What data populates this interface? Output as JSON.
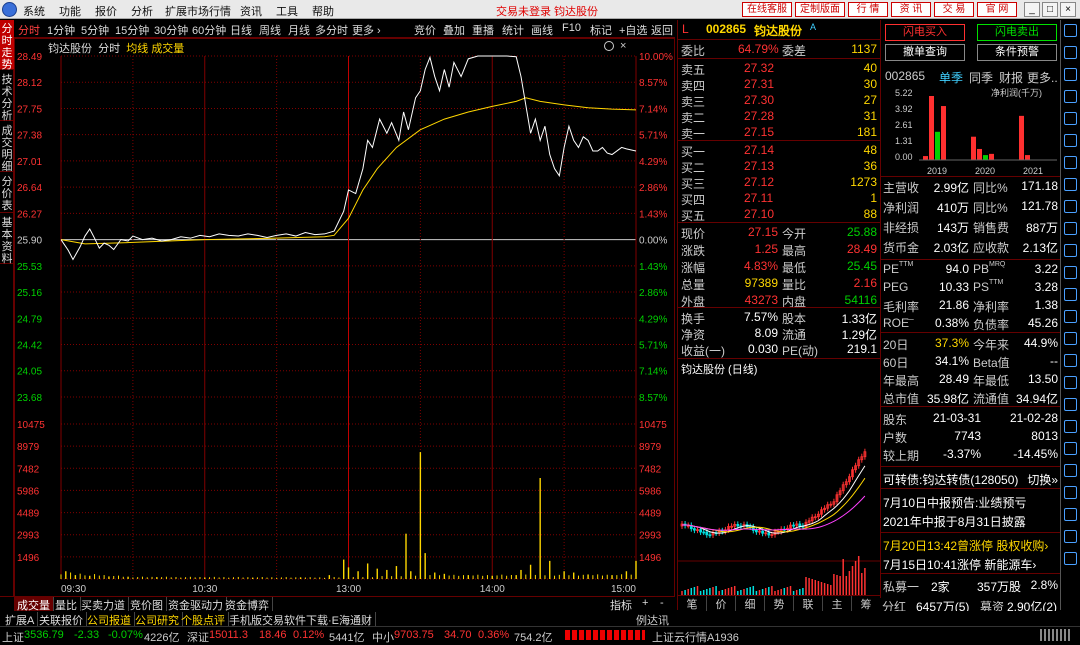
{
  "menu": {
    "items": [
      "系统",
      "功能",
      "报价",
      "分析",
      "扩展市场行情",
      "资讯",
      "工具",
      "帮助"
    ],
    "status": "交易未登录  钧达股份",
    "top_buttons": [
      "在线客服",
      "定制版面",
      "行  情",
      "资  讯",
      "交  易",
      "官  网"
    ],
    "win": [
      "_",
      "□",
      "×"
    ]
  },
  "tabs": [
    {
      "label": "分时",
      "on": true
    },
    {
      "label": "1分钟"
    },
    {
      "label": "5分钟"
    },
    {
      "label": "15分钟"
    },
    {
      "label": "30分钟"
    },
    {
      "label": "60分钟"
    },
    {
      "label": "日线"
    },
    {
      "label": "周线"
    },
    {
      "label": "月线"
    },
    {
      "label": "多分时"
    },
    {
      "label": "更多 ›"
    },
    {
      "label": "竞价"
    },
    {
      "label": "叠加"
    },
    {
      "label": "重播"
    },
    {
      "label": "统计"
    },
    {
      "label": "画线"
    },
    {
      "label": "F10"
    },
    {
      "label": "标记"
    },
    {
      "label": "+自选"
    },
    {
      "label": "返回"
    }
  ],
  "vtabs": [
    {
      "label": "分时走势",
      "on": true
    },
    {
      "label": "技术分析"
    },
    {
      "label": "成交明细"
    },
    {
      "label": "分价表"
    },
    {
      "label": "基本资料"
    }
  ],
  "chart_caption": {
    "name": "钧达股份",
    "mode": "分时",
    "avg": "均线",
    "vol": "成交量"
  },
  "chart_data": {
    "type": "line",
    "price_ticks": [
      "28.49",
      "28.12",
      "27.75",
      "27.38",
      "27.01",
      "26.64",
      "26.27",
      "25.90",
      "25.53",
      "25.16",
      "24.79",
      "24.42",
      "24.05",
      "23.68"
    ],
    "pct_ticks": [
      "10.00%",
      "8.57%",
      "7.14%",
      "5.71%",
      "4.29%",
      "2.86%",
      "1.43%",
      "0.00%",
      "1.43%",
      "2.86%",
      "4.29%",
      "5.71%",
      "7.14%",
      "8.57%"
    ],
    "vol_ticks": [
      "10475",
      "8979",
      "7482",
      "5986",
      "4489",
      "2993",
      "1496"
    ],
    "time_ticks": [
      "09:30",
      "10:30",
      "13:00",
      "14:00",
      "15:00"
    ],
    "prev_close": 25.9,
    "ylim": [
      23.31,
      28.49
    ],
    "price": [
      [
        0,
        25.9
      ],
      [
        3,
        25.75
      ],
      [
        5,
        25.62
      ],
      [
        8,
        25.8
      ],
      [
        10,
        25.95
      ],
      [
        12,
        26.05
      ],
      [
        14,
        25.92
      ],
      [
        16,
        25.78
      ],
      [
        18,
        25.85
      ],
      [
        20,
        25.82
      ],
      [
        22,
        25.76
      ],
      [
        25,
        25.9
      ],
      [
        28,
        25.88
      ],
      [
        30,
        25.95
      ],
      [
        34,
        25.9
      ],
      [
        38,
        25.92
      ],
      [
        42,
        25.88
      ],
      [
        46,
        25.9
      ],
      [
        50,
        25.94
      ],
      [
        54,
        25.92
      ],
      [
        58,
        25.96
      ],
      [
        62,
        25.94
      ],
      [
        66,
        25.98
      ],
      [
        70,
        25.96
      ],
      [
        74,
        25.95
      ],
      [
        78,
        25.98
      ],
      [
        82,
        25.96
      ],
      [
        86,
        25.93
      ],
      [
        90,
        25.96
      ],
      [
        94,
        25.98
      ],
      [
        98,
        25.95
      ],
      [
        102,
        26.0
      ],
      [
        106,
        25.97
      ],
      [
        110,
        25.98
      ],
      [
        114,
        26.02
      ],
      [
        118,
        26.3
      ],
      [
        120,
        26.6
      ],
      [
        123,
        26.55
      ],
      [
        126,
        26.9
      ],
      [
        128,
        27.3
      ],
      [
        130,
        27.2
      ],
      [
        133,
        27.6
      ],
      [
        136,
        27.4
      ],
      [
        138,
        27.55
      ],
      [
        141,
        27.3
      ],
      [
        143,
        27.7
      ],
      [
        145,
        27.45
      ],
      [
        148,
        27.9
      ],
      [
        150,
        28.0
      ],
      [
        152,
        28.3
      ],
      [
        154,
        28.47
      ],
      [
        156,
        28.2
      ],
      [
        158,
        28.0
      ],
      [
        160,
        28.3
      ],
      [
        162,
        28.05
      ],
      [
        164,
        28.4
      ],
      [
        167,
        28.2
      ],
      [
        170,
        28.45
      ],
      [
        174,
        28.49
      ],
      [
        180,
        28.49
      ],
      [
        186,
        28.49
      ],
      [
        190,
        28.48
      ],
      [
        192,
        28.2
      ],
      [
        194,
        27.8
      ],
      [
        196,
        27.4
      ],
      [
        198,
        27.6
      ],
      [
        200,
        27.3
      ],
      [
        202,
        27.5
      ],
      [
        204,
        27.1
      ],
      [
        206,
        26.9
      ],
      [
        208,
        26.8
      ],
      [
        210,
        27.2
      ],
      [
        212,
        27.5
      ],
      [
        214,
        27.3
      ],
      [
        216,
        27.2
      ],
      [
        218,
        27.35
      ],
      [
        220,
        27.3
      ],
      [
        222,
        27.15
      ],
      [
        224,
        27.15
      ],
      [
        226,
        27.2
      ],
      [
        228,
        27.12
      ],
      [
        230,
        27.1
      ],
      [
        234,
        27.2
      ],
      [
        236,
        27.18
      ],
      [
        240,
        27.15
      ]
    ],
    "avg": [
      [
        0,
        25.9
      ],
      [
        10,
        25.84
      ],
      [
        30,
        25.86
      ],
      [
        60,
        25.9
      ],
      [
        90,
        25.92
      ],
      [
        110,
        25.94
      ],
      [
        114,
        25.96
      ],
      [
        120,
        26.2
      ],
      [
        126,
        26.6
      ],
      [
        132,
        26.9
      ],
      [
        140,
        27.2
      ],
      [
        150,
        27.45
      ],
      [
        160,
        27.6
      ],
      [
        170,
        27.7
      ],
      [
        180,
        27.78
      ],
      [
        190,
        27.85
      ],
      [
        194,
        27.9
      ],
      [
        200,
        27.85
      ],
      [
        210,
        27.8
      ],
      [
        220,
        27.76
      ],
      [
        230,
        27.74
      ],
      [
        240,
        27.73
      ]
    ],
    "volume": [
      [
        2,
        600
      ],
      [
        6,
        300
      ],
      [
        12,
        250
      ],
      [
        20,
        200
      ],
      [
        28,
        180
      ],
      [
        40,
        150
      ],
      [
        60,
        120
      ],
      [
        80,
        110
      ],
      [
        100,
        130
      ],
      [
        112,
        300
      ],
      [
        118,
        1500
      ],
      [
        120,
        900
      ],
      [
        124,
        600
      ],
      [
        128,
        1200
      ],
      [
        132,
        800
      ],
      [
        136,
        700
      ],
      [
        140,
        1000
      ],
      [
        144,
        3500
      ],
      [
        146,
        600
      ],
      [
        150,
        9800
      ],
      [
        152,
        2000
      ],
      [
        156,
        500
      ],
      [
        160,
        400
      ],
      [
        170,
        300
      ],
      [
        180,
        250
      ],
      [
        190,
        300
      ],
      [
        192,
        700
      ],
      [
        196,
        1100
      ],
      [
        200,
        7800
      ],
      [
        204,
        1400
      ],
      [
        210,
        600
      ],
      [
        214,
        500
      ],
      [
        220,
        350
      ],
      [
        230,
        300
      ],
      [
        236,
        600
      ],
      [
        240,
        1400
      ]
    ],
    "vlim": [
      0,
      11971
    ]
  },
  "bottom_tabs": [
    {
      "label": "成交量",
      "on": true
    },
    {
      "label": "量比"
    },
    {
      "label": "买卖力道"
    },
    {
      "label": "竞价图"
    },
    {
      "label": "资金驱动力"
    },
    {
      "label": "资金博弈"
    }
  ],
  "bottom_right": [
    "指标",
    "+",
    "-"
  ],
  "quote": {
    "flag": "L",
    "code": "002865",
    "name": "钧达股份",
    "tag": "A",
    "weibi_label": "委比",
    "weibi": "64.79%",
    "weicha_label": "委差",
    "weicha": "1137",
    "asks": [
      {
        "l": "卖五",
        "p": "27.32",
        "v": "40"
      },
      {
        "l": "卖四",
        "p": "27.31",
        "v": "30"
      },
      {
        "l": "卖三",
        "p": "27.30",
        "v": "27"
      },
      {
        "l": "卖二",
        "p": "27.28",
        "v": "31"
      },
      {
        "l": "卖一",
        "p": "27.15",
        "v": "181"
      }
    ],
    "bids": [
      {
        "l": "买一",
        "p": "27.14",
        "v": "48"
      },
      {
        "l": "买二",
        "p": "27.13",
        "v": "36"
      },
      {
        "l": "买三",
        "p": "27.12",
        "v": "1273"
      },
      {
        "l": "买四",
        "p": "27.11",
        "v": "1"
      },
      {
        "l": "买五",
        "p": "27.10",
        "v": "88"
      }
    ],
    "stats": [
      {
        "a": "现价",
        "av": "27.15",
        "ac": "red",
        "b": "今开",
        "bv": "25.88",
        "bc": "green"
      },
      {
        "a": "涨跌",
        "av": "1.25",
        "ac": "red",
        "b": "最高",
        "bv": "28.49",
        "bc": "red"
      },
      {
        "a": "涨幅",
        "av": "4.83%",
        "ac": "red",
        "b": "最低",
        "bv": "25.45",
        "bc": "green"
      },
      {
        "a": "总量",
        "av": "97389",
        "ac": "yellow",
        "b": "量比",
        "bv": "2.16",
        "bc": "red"
      },
      {
        "a": "外盘",
        "av": "43273",
        "ac": "red",
        "b": "内盘",
        "bv": "54116",
        "bc": "green"
      }
    ],
    "stats2": [
      {
        "a": "换手",
        "av": "7.57%",
        "b": "股本",
        "bv": "1.33亿"
      },
      {
        "a": "净资",
        "av": "8.09",
        "b": "流通",
        "bv": "1.29亿"
      },
      {
        "a": "收益(一)",
        "av": "0.030",
        "b": "PE(动)",
        "bv": "219.1"
      }
    ],
    "daily_title": "钧达股份 (日线)",
    "bottom_tabs": [
      "笔",
      "价",
      "细",
      "势",
      "联",
      "主",
      "筹"
    ]
  },
  "right": {
    "btn_buy": "闪电买入",
    "btn_sell": "闪电卖出",
    "btn_cancel": "撤单查询",
    "btn_cond": "条件预警",
    "code": "002865",
    "tabs": [
      "单季",
      "同季",
      "财报",
      "更多.."
    ],
    "ylabel": "净利润(千万)",
    "bar_ticks": [
      "5.22",
      "3.92",
      "2.61",
      "1.31",
      "0.00"
    ],
    "bar_years": [
      "2019",
      "2020",
      "2021"
    ],
    "rows": [
      {
        "a": "主营收",
        "av": "2.99亿",
        "b": "同比%",
        "bv": "171.18"
      },
      {
        "a": "净利润",
        "av": "410万",
        "b": "同比%",
        "bv": "121.78"
      },
      {
        "a": "非经损",
        "av": "143万",
        "b": "销售费",
        "bv": "887万"
      },
      {
        "a": "货币金",
        "av": "2.03亿",
        "b": "应收款",
        "bv": "2.13亿"
      }
    ],
    "rows2": [
      {
        "a": "PE",
        "sup": "TTM",
        "av": "94.0",
        "b": "PB",
        "sup2": "MRQ",
        "bv": "3.22"
      },
      {
        "a": "PEG",
        "sup": "",
        "av": "10.33",
        "b": "PS",
        "sup2": "TTM",
        "bv": "3.28"
      },
      {
        "a": "毛利率",
        "sup": "",
        "av": "21.86",
        "b": "净利率",
        "sup2": "",
        "bv": "1.38"
      },
      {
        "a": "ROE",
        "sup": "一",
        "av": "0.38%",
        "b": "负债率",
        "sup2": "",
        "bv": "45.26"
      }
    ],
    "rows3": [
      {
        "a": "20日",
        "av": "37.3%",
        "b": "今年来",
        "bv": "44.9%",
        "ac": "yellow"
      },
      {
        "a": "60日",
        "av": "34.1%",
        "b": "Beta值",
        "bv": "--"
      },
      {
        "a": "年最高",
        "av": "28.49",
        "b": "年最低",
        "bv": "13.50"
      },
      {
        "a": "总市值",
        "av": "35.98亿",
        "b": "流通值",
        "bv": "34.94亿"
      }
    ],
    "rows4": [
      {
        "a": "股东",
        "av": "21-03-31",
        "b": "",
        "bv": "21-02-28"
      },
      {
        "a": "户数",
        "av": "7743",
        "b": "",
        "bv": "8013"
      },
      {
        "a": "较上期",
        "av": "-3.37%",
        "b": "",
        "bv": "-14.45%"
      }
    ],
    "bond": "可转债:钧达转债(128050)",
    "bond_switch": "切换»",
    "news": [
      "7月10日中报预告:业绩预亏",
      "2021年中报于8月31日披露"
    ],
    "news2": [
      "7月20日13:42曾涨停 股权收购›",
      "7月15日10:41涨停 新能源车›"
    ],
    "placement": {
      "a": "私募一",
      "b": "2家",
      "c": "357万股",
      "d": "2.8%"
    },
    "dividend": {
      "a": "分红",
      "b": "6457万(5)",
      "c": "募资",
      "d": "2.90亿(2)"
    }
  },
  "status1": {
    "items": [
      "扩展A",
      "关联报价",
      "公司报道",
      "公司研究",
      "个股点评",
      "手机版交易软件下载·E海通财"
    ],
    "right": "例达讯"
  },
  "status2": [
    {
      "n": "上证",
      "p": "3536.79",
      "d": "-2.33",
      "r": "-0.07%",
      "v": "4226亿",
      "c": "green"
    },
    {
      "n": "深证",
      "p": "15011.3",
      "d": "18.46",
      "r": "0.12%",
      "v": "5441亿",
      "c": "red"
    },
    {
      "n": "中小",
      "p": "9703.75",
      "d": "34.70",
      "r": "0.36%",
      "v": "754.2亿",
      "c": "red"
    }
  ],
  "status_right": "上证云行情A1936"
}
